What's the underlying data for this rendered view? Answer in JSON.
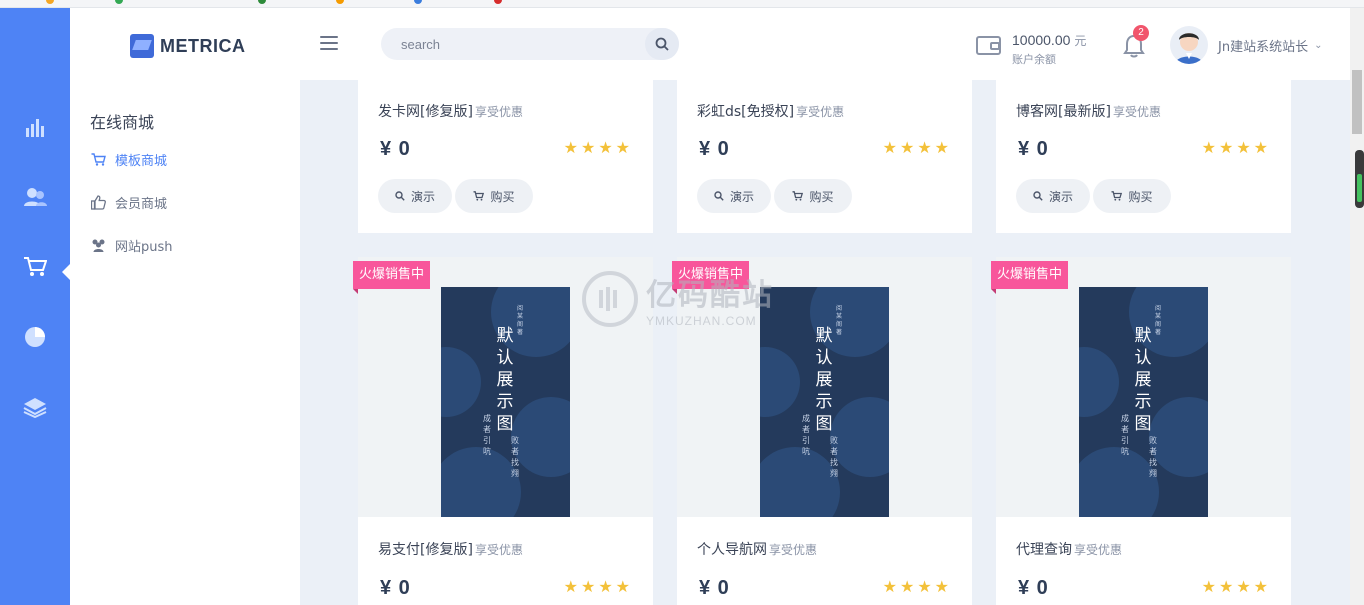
{
  "app": {
    "logo_text": "METRICA"
  },
  "header": {
    "search_placeholder": "search",
    "wallet_amount": "10000.00",
    "wallet_unit": "元",
    "wallet_label": "账户余额",
    "notification_count": "2",
    "user_name": "Jn建站系统站长"
  },
  "rail": {
    "items": [
      {
        "icon": "bar-chart-icon",
        "active": false
      },
      {
        "icon": "users-icon",
        "active": false
      },
      {
        "icon": "cart-icon",
        "active": true
      },
      {
        "icon": "pie-chart-icon",
        "active": false
      },
      {
        "icon": "layers-icon",
        "active": false
      }
    ]
  },
  "subnav": {
    "title": "在线商城",
    "items": [
      {
        "label": "模板商城",
        "icon": "cart-icon",
        "active": true
      },
      {
        "label": "会员商城",
        "icon": "thumbs-up-icon",
        "active": false
      },
      {
        "label": "网站push",
        "icon": "group-icon",
        "active": false
      }
    ]
  },
  "products": [
    {
      "name": "发卡网[修复版]",
      "hint": "享受优惠",
      "price": "¥ 0",
      "rating": 4,
      "demo": "演示",
      "buy": "购买"
    },
    {
      "name": "彩虹ds[免授权]",
      "hint": "享受优惠",
      "price": "¥ 0",
      "rating": 4,
      "demo": "演示",
      "buy": "购买"
    },
    {
      "name": "博客网[最新版]",
      "hint": "享受优惠",
      "price": "¥ 0",
      "rating": 4,
      "demo": "演示",
      "buy": "购买"
    },
    {
      "name": "易支付[修复版]",
      "hint": "享受优惠",
      "price": "¥ 0",
      "rating": 4,
      "badge": "火爆销售中"
    },
    {
      "name": "个人导航网",
      "hint": "享受优惠",
      "price": "¥ 0",
      "rating": 4,
      "badge": "火爆销售中"
    },
    {
      "name": "代理查询",
      "hint": "享受优惠",
      "price": "¥ 0",
      "rating": 4,
      "badge": "火爆销售中"
    }
  ],
  "cover": {
    "title": "默认展示图",
    "side_left": "成者引吭",
    "side_right": "败者找翙",
    "author": "阅某阁著"
  },
  "watermark": {
    "cn": "亿码酷站",
    "en": "YMKUZHAN.COM"
  },
  "colors": {
    "accent": "#4e83f5",
    "badge": "#f8569b",
    "star": "#f3c13a",
    "badge_red": "#f1556c"
  }
}
